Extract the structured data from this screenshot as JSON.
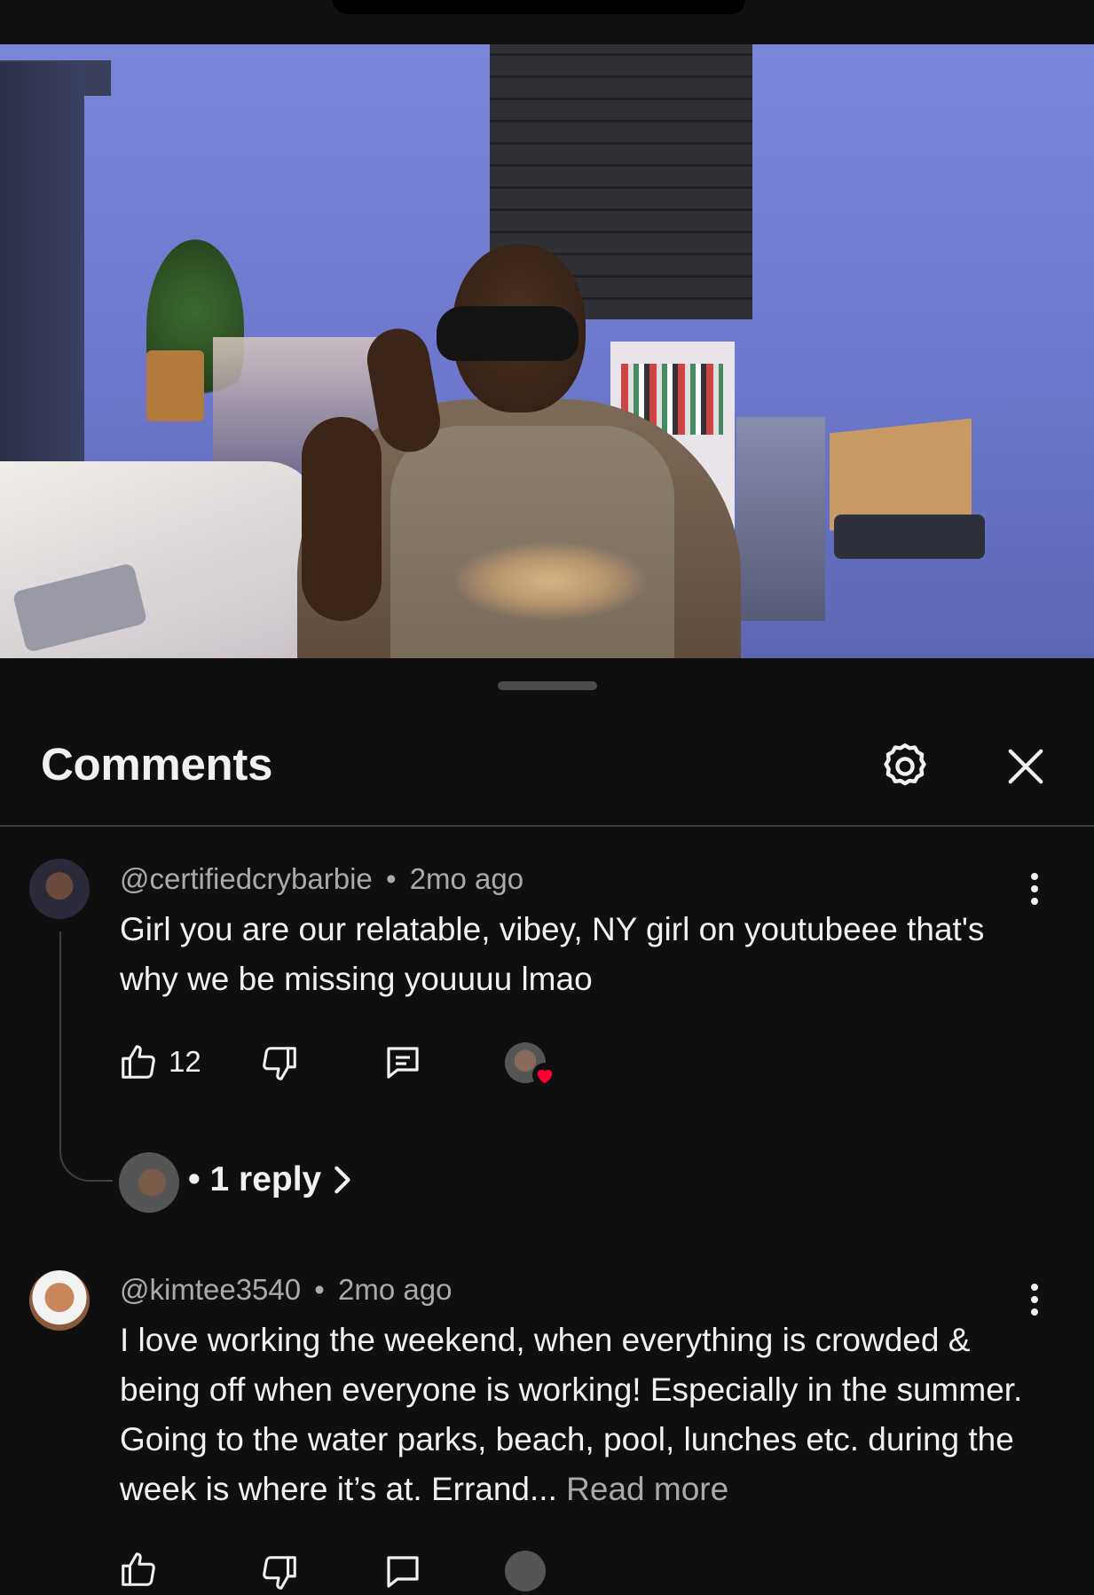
{
  "header": {
    "title": "Comments"
  },
  "comments": [
    {
      "author": "@certifiedcrybarbie",
      "separator": "•",
      "time": "2mo ago",
      "text": "Girl you are our relatable, vibey, NY girl on youtubeee that's why we be missing youuuu lmao",
      "likes": "12",
      "replies_label": "• 1 reply"
    },
    {
      "author": "@kimtee3540",
      "separator": "•",
      "time": "2mo ago",
      "text": "I love working the weekend, when everything is crowded & being off when everyone is working! Especially in the summer. Going to the water parks, beach, pool, lunches etc. during the week is where it’s at. Errand...",
      "read_more": "Read more"
    }
  ],
  "colors": {
    "background": "#0f0f0f",
    "text_primary": "#f1f1f1",
    "text_secondary": "#aaaaaa",
    "heart": "#ff0033"
  },
  "icons": [
    "gear-icon",
    "close-icon",
    "more-vert-icon",
    "thumbs-up-icon",
    "thumbs-down-icon",
    "reply-icon",
    "heart-icon",
    "chevron-right-icon"
  ]
}
